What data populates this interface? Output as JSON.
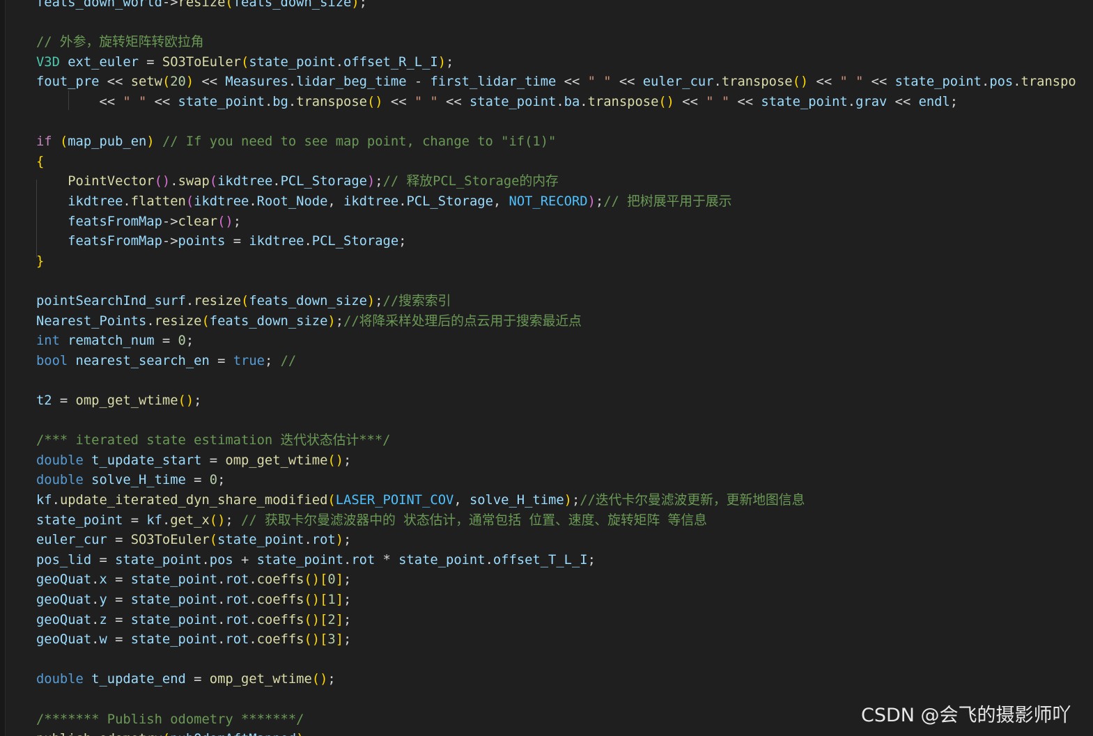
{
  "editor": {
    "lines": [
      [
        {
          "t": "feats_down_world",
          "c": "var"
        },
        {
          "t": "->",
          "c": "op"
        },
        {
          "t": "resize",
          "c": "fn"
        },
        {
          "t": "(",
          "c": "p1"
        },
        {
          "t": "feats_down_size",
          "c": "var"
        },
        {
          "t": ")",
          "c": "p1"
        },
        {
          "t": ";",
          "c": "op"
        }
      ],
      [],
      [
        {
          "t": "// 外参，旋转矩阵转欧拉角",
          "c": "cmt"
        }
      ],
      [
        {
          "t": "V3D",
          "c": "cls"
        },
        {
          "t": " ",
          "c": "op"
        },
        {
          "t": "ext_euler",
          "c": "var"
        },
        {
          "t": " = ",
          "c": "op"
        },
        {
          "t": "SO3ToEuler",
          "c": "fn"
        },
        {
          "t": "(",
          "c": "p1"
        },
        {
          "t": "state_point",
          "c": "var"
        },
        {
          "t": ".",
          "c": "op"
        },
        {
          "t": "offset_R_L_I",
          "c": "var"
        },
        {
          "t": ")",
          "c": "p1"
        },
        {
          "t": ";",
          "c": "op"
        }
      ],
      [
        {
          "t": "fout_pre",
          "c": "var"
        },
        {
          "t": " << ",
          "c": "op"
        },
        {
          "t": "setw",
          "c": "fn"
        },
        {
          "t": "(",
          "c": "p1"
        },
        {
          "t": "20",
          "c": "num"
        },
        {
          "t": ")",
          "c": "p1"
        },
        {
          "t": " << ",
          "c": "op"
        },
        {
          "t": "Measures",
          "c": "var"
        },
        {
          "t": ".",
          "c": "op"
        },
        {
          "t": "lidar_beg_time",
          "c": "var"
        },
        {
          "t": " - ",
          "c": "op"
        },
        {
          "t": "first_lidar_time",
          "c": "var"
        },
        {
          "t": " << ",
          "c": "op"
        },
        {
          "t": "\" \"",
          "c": "str"
        },
        {
          "t": " << ",
          "c": "op"
        },
        {
          "t": "euler_cur",
          "c": "var"
        },
        {
          "t": ".",
          "c": "op"
        },
        {
          "t": "transpose",
          "c": "fn"
        },
        {
          "t": "()",
          "c": "p1"
        },
        {
          "t": " << ",
          "c": "op"
        },
        {
          "t": "\" \"",
          "c": "str"
        },
        {
          "t": " << ",
          "c": "op"
        },
        {
          "t": "state_point",
          "c": "var"
        },
        {
          "t": ".",
          "c": "op"
        },
        {
          "t": "pos",
          "c": "var"
        },
        {
          "t": ".",
          "c": "op"
        },
        {
          "t": "transpo",
          "c": "fn"
        }
      ],
      [
        {
          "t": "        << ",
          "c": "op"
        },
        {
          "t": "\" \"",
          "c": "str"
        },
        {
          "t": " << ",
          "c": "op"
        },
        {
          "t": "state_point",
          "c": "var"
        },
        {
          "t": ".",
          "c": "op"
        },
        {
          "t": "bg",
          "c": "var"
        },
        {
          "t": ".",
          "c": "op"
        },
        {
          "t": "transpose",
          "c": "fn"
        },
        {
          "t": "()",
          "c": "p1"
        },
        {
          "t": " << ",
          "c": "op"
        },
        {
          "t": "\" \"",
          "c": "str"
        },
        {
          "t": " << ",
          "c": "op"
        },
        {
          "t": "state_point",
          "c": "var"
        },
        {
          "t": ".",
          "c": "op"
        },
        {
          "t": "ba",
          "c": "var"
        },
        {
          "t": ".",
          "c": "op"
        },
        {
          "t": "transpose",
          "c": "fn"
        },
        {
          "t": "()",
          "c": "p1"
        },
        {
          "t": " << ",
          "c": "op"
        },
        {
          "t": "\" \"",
          "c": "str"
        },
        {
          "t": " << ",
          "c": "op"
        },
        {
          "t": "state_point",
          "c": "var"
        },
        {
          "t": ".",
          "c": "op"
        },
        {
          "t": "grav",
          "c": "var"
        },
        {
          "t": " << ",
          "c": "op"
        },
        {
          "t": "endl",
          "c": "var"
        },
        {
          "t": ";",
          "c": "op"
        }
      ],
      [],
      [
        {
          "t": "if",
          "c": "kw"
        },
        {
          "t": " ",
          "c": "op"
        },
        {
          "t": "(",
          "c": "p1"
        },
        {
          "t": "map_pub_en",
          "c": "var"
        },
        {
          "t": ")",
          "c": "p1"
        },
        {
          "t": " // If you need to see map point, change to \"if(1)\"",
          "c": "cmt"
        }
      ],
      [
        {
          "t": "{",
          "c": "p1"
        }
      ],
      [
        {
          "t": "    ",
          "c": "op"
        },
        {
          "t": "PointVector",
          "c": "fn"
        },
        {
          "t": "()",
          "c": "p2"
        },
        {
          "t": ".",
          "c": "op"
        },
        {
          "t": "swap",
          "c": "fn"
        },
        {
          "t": "(",
          "c": "p2"
        },
        {
          "t": "ikdtree",
          "c": "var"
        },
        {
          "t": ".",
          "c": "op"
        },
        {
          "t": "PCL_Storage",
          "c": "var"
        },
        {
          "t": ")",
          "c": "p2"
        },
        {
          "t": ";",
          "c": "op"
        },
        {
          "t": "// 释放PCL_Storage的内存",
          "c": "cmt"
        }
      ],
      [
        {
          "t": "    ",
          "c": "op"
        },
        {
          "t": "ikdtree",
          "c": "var"
        },
        {
          "t": ".",
          "c": "op"
        },
        {
          "t": "flatten",
          "c": "fn"
        },
        {
          "t": "(",
          "c": "p2"
        },
        {
          "t": "ikdtree",
          "c": "var"
        },
        {
          "t": ".",
          "c": "op"
        },
        {
          "t": "Root_Node",
          "c": "var"
        },
        {
          "t": ", ",
          "c": "op"
        },
        {
          "t": "ikdtree",
          "c": "var"
        },
        {
          "t": ".",
          "c": "op"
        },
        {
          "t": "PCL_Storage",
          "c": "var"
        },
        {
          "t": ", ",
          "c": "op"
        },
        {
          "t": "NOT_RECORD",
          "c": "const"
        },
        {
          "t": ")",
          "c": "p2"
        },
        {
          "t": ";",
          "c": "op"
        },
        {
          "t": "// 把树展平用于展示",
          "c": "cmt"
        }
      ],
      [
        {
          "t": "    ",
          "c": "op"
        },
        {
          "t": "featsFromMap",
          "c": "var"
        },
        {
          "t": "->",
          "c": "op"
        },
        {
          "t": "clear",
          "c": "fn"
        },
        {
          "t": "()",
          "c": "p2"
        },
        {
          "t": ";",
          "c": "op"
        }
      ],
      [
        {
          "t": "    ",
          "c": "op"
        },
        {
          "t": "featsFromMap",
          "c": "var"
        },
        {
          "t": "->",
          "c": "op"
        },
        {
          "t": "points",
          "c": "var"
        },
        {
          "t": " = ",
          "c": "op"
        },
        {
          "t": "ikdtree",
          "c": "var"
        },
        {
          "t": ".",
          "c": "op"
        },
        {
          "t": "PCL_Storage",
          "c": "var"
        },
        {
          "t": ";",
          "c": "op"
        }
      ],
      [
        {
          "t": "}",
          "c": "p1"
        }
      ],
      [],
      [
        {
          "t": "pointSearchInd_surf",
          "c": "var"
        },
        {
          "t": ".",
          "c": "op"
        },
        {
          "t": "resize",
          "c": "fn"
        },
        {
          "t": "(",
          "c": "p1"
        },
        {
          "t": "feats_down_size",
          "c": "var"
        },
        {
          "t": ")",
          "c": "p1"
        },
        {
          "t": ";",
          "c": "op"
        },
        {
          "t": "//搜索索引",
          "c": "cmt"
        }
      ],
      [
        {
          "t": "Nearest_Points",
          "c": "var"
        },
        {
          "t": ".",
          "c": "op"
        },
        {
          "t": "resize",
          "c": "fn"
        },
        {
          "t": "(",
          "c": "p1"
        },
        {
          "t": "feats_down_size",
          "c": "var"
        },
        {
          "t": ")",
          "c": "p1"
        },
        {
          "t": ";",
          "c": "op"
        },
        {
          "t": "//将降采样处理后的点云用于搜索最近点",
          "c": "cmt"
        }
      ],
      [
        {
          "t": "int",
          "c": "type"
        },
        {
          "t": " ",
          "c": "op"
        },
        {
          "t": "rematch_num",
          "c": "var"
        },
        {
          "t": " = ",
          "c": "op"
        },
        {
          "t": "0",
          "c": "num"
        },
        {
          "t": ";",
          "c": "op"
        }
      ],
      [
        {
          "t": "bool",
          "c": "type"
        },
        {
          "t": " ",
          "c": "op"
        },
        {
          "t": "nearest_search_en",
          "c": "var"
        },
        {
          "t": " = ",
          "c": "op"
        },
        {
          "t": "true",
          "c": "bool"
        },
        {
          "t": "; ",
          "c": "op"
        },
        {
          "t": "//",
          "c": "cmt"
        }
      ],
      [],
      [
        {
          "t": "t2",
          "c": "var"
        },
        {
          "t": " = ",
          "c": "op"
        },
        {
          "t": "omp_get_wtime",
          "c": "fn"
        },
        {
          "t": "()",
          "c": "p1"
        },
        {
          "t": ";",
          "c": "op"
        }
      ],
      [],
      [
        {
          "t": "/*** iterated state estimation 迭代状态估计***/",
          "c": "cmt"
        }
      ],
      [
        {
          "t": "double",
          "c": "type"
        },
        {
          "t": " ",
          "c": "op"
        },
        {
          "t": "t_update_start",
          "c": "var"
        },
        {
          "t": " = ",
          "c": "op"
        },
        {
          "t": "omp_get_wtime",
          "c": "fn"
        },
        {
          "t": "()",
          "c": "p1"
        },
        {
          "t": ";",
          "c": "op"
        }
      ],
      [
        {
          "t": "double",
          "c": "type"
        },
        {
          "t": " ",
          "c": "op"
        },
        {
          "t": "solve_H_time",
          "c": "var"
        },
        {
          "t": " = ",
          "c": "op"
        },
        {
          "t": "0",
          "c": "num"
        },
        {
          "t": ";",
          "c": "op"
        }
      ],
      [
        {
          "t": "kf",
          "c": "var"
        },
        {
          "t": ".",
          "c": "op"
        },
        {
          "t": "update_iterated_dyn_share_modified",
          "c": "fn"
        },
        {
          "t": "(",
          "c": "p1"
        },
        {
          "t": "LASER_POINT_COV",
          "c": "const"
        },
        {
          "t": ", ",
          "c": "op"
        },
        {
          "t": "solve_H_time",
          "c": "var"
        },
        {
          "t": ")",
          "c": "p1"
        },
        {
          "t": ";",
          "c": "op"
        },
        {
          "t": "//迭代卡尔曼滤波更新，更新地图信息",
          "c": "cmt"
        }
      ],
      [
        {
          "t": "state_point",
          "c": "var"
        },
        {
          "t": " = ",
          "c": "op"
        },
        {
          "t": "kf",
          "c": "var"
        },
        {
          "t": ".",
          "c": "op"
        },
        {
          "t": "get_x",
          "c": "fn"
        },
        {
          "t": "()",
          "c": "p1"
        },
        {
          "t": "; ",
          "c": "op"
        },
        {
          "t": "// 获取卡尔曼滤波器中的 状态估计，通常包括 位置、速度、旋转矩阵 等信息",
          "c": "cmt"
        }
      ],
      [
        {
          "t": "euler_cur",
          "c": "var"
        },
        {
          "t": " = ",
          "c": "op"
        },
        {
          "t": "SO3ToEuler",
          "c": "fn"
        },
        {
          "t": "(",
          "c": "p1"
        },
        {
          "t": "state_point",
          "c": "var"
        },
        {
          "t": ".",
          "c": "op"
        },
        {
          "t": "rot",
          "c": "var"
        },
        {
          "t": ")",
          "c": "p1"
        },
        {
          "t": ";",
          "c": "op"
        }
      ],
      [
        {
          "t": "pos_lid",
          "c": "var"
        },
        {
          "t": " = ",
          "c": "op"
        },
        {
          "t": "state_point",
          "c": "var"
        },
        {
          "t": ".",
          "c": "op"
        },
        {
          "t": "pos",
          "c": "var"
        },
        {
          "t": " + ",
          "c": "op"
        },
        {
          "t": "state_point",
          "c": "var"
        },
        {
          "t": ".",
          "c": "op"
        },
        {
          "t": "rot",
          "c": "var"
        },
        {
          "t": " * ",
          "c": "op"
        },
        {
          "t": "state_point",
          "c": "var"
        },
        {
          "t": ".",
          "c": "op"
        },
        {
          "t": "offset_T_L_I",
          "c": "var"
        },
        {
          "t": ";",
          "c": "op"
        }
      ],
      [
        {
          "t": "geoQuat",
          "c": "var"
        },
        {
          "t": ".",
          "c": "op"
        },
        {
          "t": "x",
          "c": "var"
        },
        {
          "t": " = ",
          "c": "op"
        },
        {
          "t": "state_point",
          "c": "var"
        },
        {
          "t": ".",
          "c": "op"
        },
        {
          "t": "rot",
          "c": "var"
        },
        {
          "t": ".",
          "c": "op"
        },
        {
          "t": "coeffs",
          "c": "fn"
        },
        {
          "t": "()",
          "c": "p1"
        },
        {
          "t": "[",
          "c": "p1"
        },
        {
          "t": "0",
          "c": "num"
        },
        {
          "t": "]",
          "c": "p1"
        },
        {
          "t": ";",
          "c": "op"
        }
      ],
      [
        {
          "t": "geoQuat",
          "c": "var"
        },
        {
          "t": ".",
          "c": "op"
        },
        {
          "t": "y",
          "c": "var"
        },
        {
          "t": " = ",
          "c": "op"
        },
        {
          "t": "state_point",
          "c": "var"
        },
        {
          "t": ".",
          "c": "op"
        },
        {
          "t": "rot",
          "c": "var"
        },
        {
          "t": ".",
          "c": "op"
        },
        {
          "t": "coeffs",
          "c": "fn"
        },
        {
          "t": "()",
          "c": "p1"
        },
        {
          "t": "[",
          "c": "p1"
        },
        {
          "t": "1",
          "c": "num"
        },
        {
          "t": "]",
          "c": "p1"
        },
        {
          "t": ";",
          "c": "op"
        }
      ],
      [
        {
          "t": "geoQuat",
          "c": "var"
        },
        {
          "t": ".",
          "c": "op"
        },
        {
          "t": "z",
          "c": "var"
        },
        {
          "t": " = ",
          "c": "op"
        },
        {
          "t": "state_point",
          "c": "var"
        },
        {
          "t": ".",
          "c": "op"
        },
        {
          "t": "rot",
          "c": "var"
        },
        {
          "t": ".",
          "c": "op"
        },
        {
          "t": "coeffs",
          "c": "fn"
        },
        {
          "t": "()",
          "c": "p1"
        },
        {
          "t": "[",
          "c": "p1"
        },
        {
          "t": "2",
          "c": "num"
        },
        {
          "t": "]",
          "c": "p1"
        },
        {
          "t": ";",
          "c": "op"
        }
      ],
      [
        {
          "t": "geoQuat",
          "c": "var"
        },
        {
          "t": ".",
          "c": "op"
        },
        {
          "t": "w",
          "c": "var"
        },
        {
          "t": " = ",
          "c": "op"
        },
        {
          "t": "state_point",
          "c": "var"
        },
        {
          "t": ".",
          "c": "op"
        },
        {
          "t": "rot",
          "c": "var"
        },
        {
          "t": ".",
          "c": "op"
        },
        {
          "t": "coeffs",
          "c": "fn"
        },
        {
          "t": "()",
          "c": "p1"
        },
        {
          "t": "[",
          "c": "p1"
        },
        {
          "t": "3",
          "c": "num"
        },
        {
          "t": "]",
          "c": "p1"
        },
        {
          "t": ";",
          "c": "op"
        }
      ],
      [],
      [
        {
          "t": "double",
          "c": "type"
        },
        {
          "t": " ",
          "c": "op"
        },
        {
          "t": "t_update_end",
          "c": "var"
        },
        {
          "t": " = ",
          "c": "op"
        },
        {
          "t": "omp_get_wtime",
          "c": "fn"
        },
        {
          "t": "()",
          "c": "p1"
        },
        {
          "t": ";",
          "c": "op"
        }
      ],
      [],
      [
        {
          "t": "/******* Publish odometry *******/",
          "c": "cmt"
        }
      ],
      [
        {
          "t": "publish_odometry",
          "c": "fn"
        },
        {
          "t": "(",
          "c": "p1"
        },
        {
          "t": "pubOdomAftMapped",
          "c": "var"
        },
        {
          "t": ")",
          "c": "p1"
        },
        {
          "t": ";",
          "c": "op"
        }
      ]
    ]
  },
  "colors": {
    "background": "#1f1f1f",
    "type": "#569cd6",
    "keyword": "#c586c0",
    "variable": "#9cdcfe",
    "function": "#dcdcaa",
    "number": "#b5cea8",
    "string": "#ce9178",
    "comment": "#6a9955",
    "constant": "#4fc1ff",
    "bracket": "#ffd700"
  },
  "watermark": {
    "text": "CSDN @会飞的摄影师吖"
  }
}
